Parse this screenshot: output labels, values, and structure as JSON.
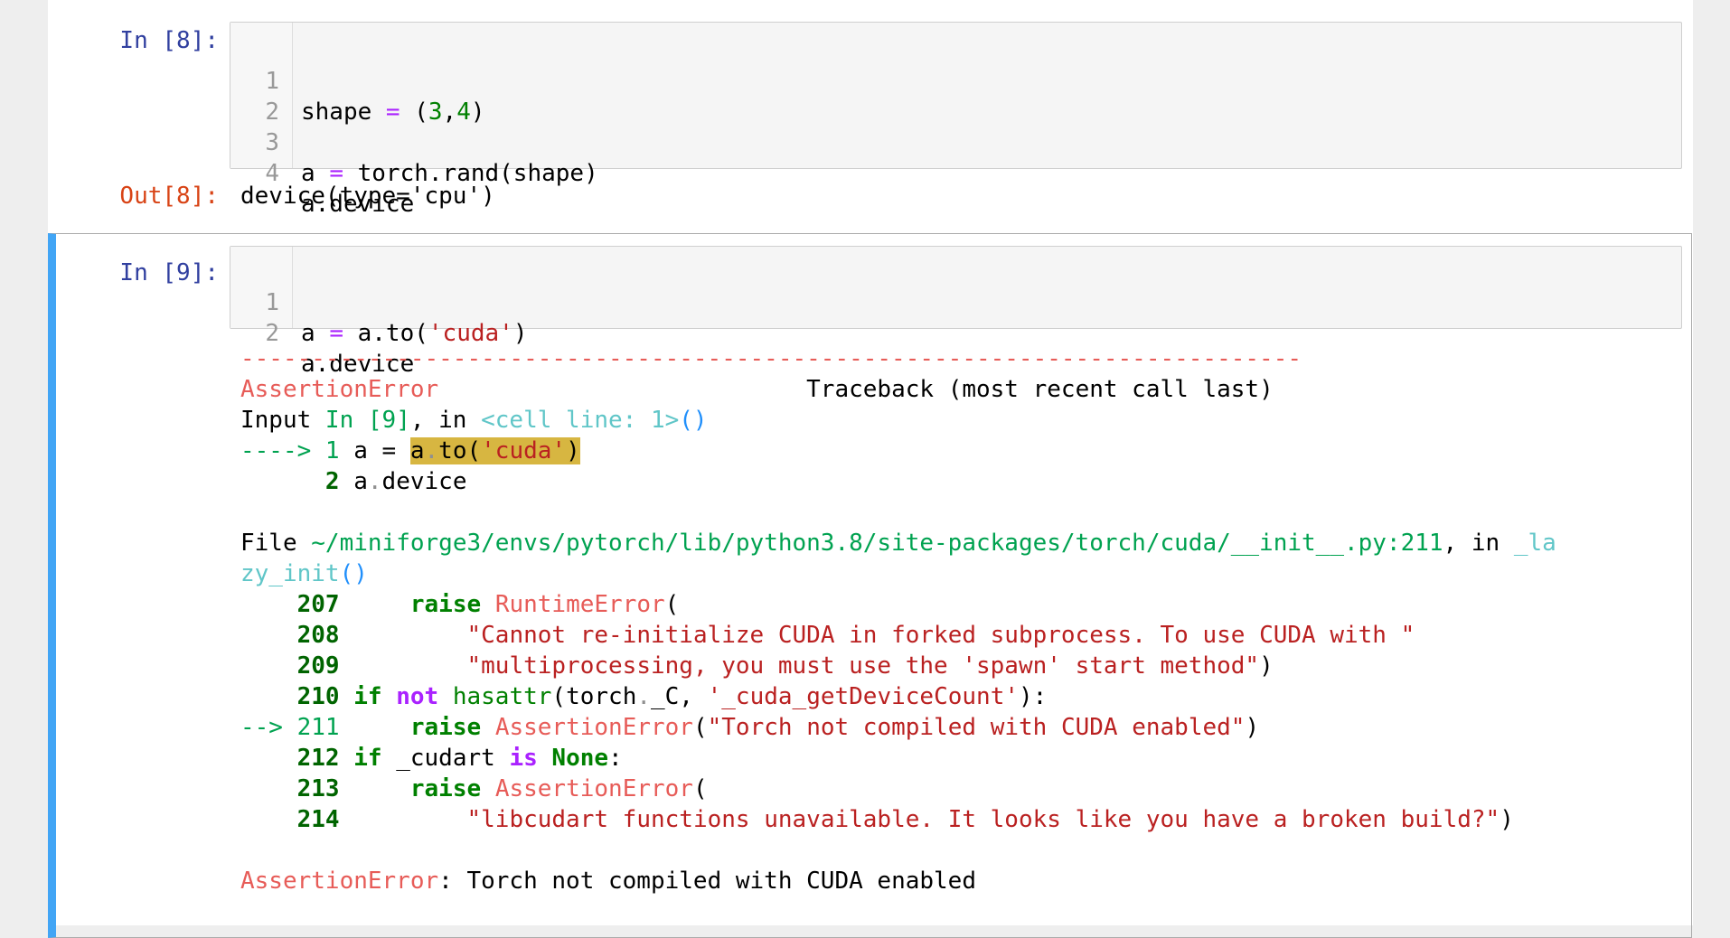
{
  "cells": [
    {
      "in_prompt": "In [8]:",
      "lines": [
        {
          "num": "1",
          "tokens": [
            "shape ",
            "=",
            " (",
            "3",
            ",",
            "4",
            ")"
          ]
        },
        {
          "num": "2",
          "tokens": []
        },
        {
          "num": "3",
          "tokens": [
            "a ",
            "=",
            " torch.rand(shape)"
          ]
        },
        {
          "num": "4",
          "tokens": [
            "a.device"
          ]
        }
      ],
      "out_prompt": "Out[8]:",
      "output": "device(type='cpu')"
    },
    {
      "in_prompt": "In [9]:",
      "lines": [
        {
          "num": "1",
          "tokens": [
            "a ",
            "=",
            " a.to(",
            "'cuda'",
            ")"
          ]
        },
        {
          "num": "2",
          "tokens": [
            "a.device"
          ]
        }
      ]
    }
  ],
  "traceback": {
    "dashes": "---------------------------------------------------------------------------",
    "error_name": "AssertionError",
    "header_spacing": "                          ",
    "header_right": "Traceback (most recent call last)",
    "input_word": "Input ",
    "input_cell": "In [9]",
    "input_in": ", in ",
    "input_link": "<cell line: 1>",
    "input_parens": "()",
    "arrow1": "----> 1",
    "arrow1_pre": " a = ",
    "arrow1_a": "a",
    "arrow1_dot": ".",
    "arrow1_to": "to(",
    "arrow1_str": "'cuda'",
    "arrow1_close": ")",
    "line2_num": "      2",
    "line2_a": " a",
    "line2_dot": ".",
    "line2_rest": "device",
    "file_word": "File ",
    "file_path": "~/miniforge3/envs/pytorch/lib/python3.8/site-packages/torch/cuda/__init__.py:211",
    "file_in": ", in ",
    "file_func_a": "_la",
    "file_func_b": "zy_init",
    "file_func_parens": "()",
    "src": [
      {
        "num": "207",
        "text": "raise RuntimeError("
      },
      {
        "num": "208",
        "text": "\"Cannot re-initialize CUDA in forked subprocess. To use CUDA with \""
      },
      {
        "num": "209",
        "text": "\"multiprocessing, you must use the 'spawn' start method\")"
      },
      {
        "num": "210",
        "text": "if not hasattr(torch._C, '_cuda_getDeviceCount'):"
      },
      {
        "num": "211",
        "text": "raise AssertionError(\"Torch not compiled with CUDA enabled\")"
      },
      {
        "num": "212",
        "text": "if _cudart is None:"
      },
      {
        "num": "213",
        "text": "raise AssertionError("
      },
      {
        "num": "214",
        "text": "\"libcudart functions unavailable. It looks like you have a broken build?\")"
      }
    ],
    "current_arrow": "--> ",
    "final_error": "AssertionError",
    "final_message": ": Torch not compiled with CUDA enabled"
  },
  "colors": {
    "selected_border": "#42a5f5",
    "in_prompt": "#303f9f",
    "out_prompt": "#d84315",
    "error_red": "#e75c58",
    "highlight": "#d7b641"
  }
}
